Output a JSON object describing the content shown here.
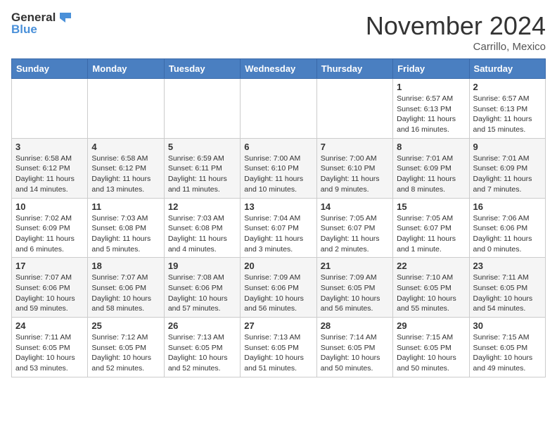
{
  "header": {
    "logo_general": "General",
    "logo_blue": "Blue",
    "month_title": "November 2024",
    "location": "Carrillo, Mexico"
  },
  "calendar": {
    "days_of_week": [
      "Sunday",
      "Monday",
      "Tuesday",
      "Wednesday",
      "Thursday",
      "Friday",
      "Saturday"
    ],
    "weeks": [
      [
        {
          "day": "",
          "info": ""
        },
        {
          "day": "",
          "info": ""
        },
        {
          "day": "",
          "info": ""
        },
        {
          "day": "",
          "info": ""
        },
        {
          "day": "",
          "info": ""
        },
        {
          "day": "1",
          "info": "Sunrise: 6:57 AM\nSunset: 6:13 PM\nDaylight: 11 hours\nand 16 minutes."
        },
        {
          "day": "2",
          "info": "Sunrise: 6:57 AM\nSunset: 6:13 PM\nDaylight: 11 hours\nand 15 minutes."
        }
      ],
      [
        {
          "day": "3",
          "info": "Sunrise: 6:58 AM\nSunset: 6:12 PM\nDaylight: 11 hours\nand 14 minutes."
        },
        {
          "day": "4",
          "info": "Sunrise: 6:58 AM\nSunset: 6:12 PM\nDaylight: 11 hours\nand 13 minutes."
        },
        {
          "day": "5",
          "info": "Sunrise: 6:59 AM\nSunset: 6:11 PM\nDaylight: 11 hours\nand 11 minutes."
        },
        {
          "day": "6",
          "info": "Sunrise: 7:00 AM\nSunset: 6:10 PM\nDaylight: 11 hours\nand 10 minutes."
        },
        {
          "day": "7",
          "info": "Sunrise: 7:00 AM\nSunset: 6:10 PM\nDaylight: 11 hours\nand 9 minutes."
        },
        {
          "day": "8",
          "info": "Sunrise: 7:01 AM\nSunset: 6:09 PM\nDaylight: 11 hours\nand 8 minutes."
        },
        {
          "day": "9",
          "info": "Sunrise: 7:01 AM\nSunset: 6:09 PM\nDaylight: 11 hours\nand 7 minutes."
        }
      ],
      [
        {
          "day": "10",
          "info": "Sunrise: 7:02 AM\nSunset: 6:09 PM\nDaylight: 11 hours\nand 6 minutes."
        },
        {
          "day": "11",
          "info": "Sunrise: 7:03 AM\nSunset: 6:08 PM\nDaylight: 11 hours\nand 5 minutes."
        },
        {
          "day": "12",
          "info": "Sunrise: 7:03 AM\nSunset: 6:08 PM\nDaylight: 11 hours\nand 4 minutes."
        },
        {
          "day": "13",
          "info": "Sunrise: 7:04 AM\nSunset: 6:07 PM\nDaylight: 11 hours\nand 3 minutes."
        },
        {
          "day": "14",
          "info": "Sunrise: 7:05 AM\nSunset: 6:07 PM\nDaylight: 11 hours\nand 2 minutes."
        },
        {
          "day": "15",
          "info": "Sunrise: 7:05 AM\nSunset: 6:07 PM\nDaylight: 11 hours\nand 1 minute."
        },
        {
          "day": "16",
          "info": "Sunrise: 7:06 AM\nSunset: 6:06 PM\nDaylight: 11 hours\nand 0 minutes."
        }
      ],
      [
        {
          "day": "17",
          "info": "Sunrise: 7:07 AM\nSunset: 6:06 PM\nDaylight: 10 hours\nand 59 minutes."
        },
        {
          "day": "18",
          "info": "Sunrise: 7:07 AM\nSunset: 6:06 PM\nDaylight: 10 hours\nand 58 minutes."
        },
        {
          "day": "19",
          "info": "Sunrise: 7:08 AM\nSunset: 6:06 PM\nDaylight: 10 hours\nand 57 minutes."
        },
        {
          "day": "20",
          "info": "Sunrise: 7:09 AM\nSunset: 6:06 PM\nDaylight: 10 hours\nand 56 minutes."
        },
        {
          "day": "21",
          "info": "Sunrise: 7:09 AM\nSunset: 6:05 PM\nDaylight: 10 hours\nand 56 minutes."
        },
        {
          "day": "22",
          "info": "Sunrise: 7:10 AM\nSunset: 6:05 PM\nDaylight: 10 hours\nand 55 minutes."
        },
        {
          "day": "23",
          "info": "Sunrise: 7:11 AM\nSunset: 6:05 PM\nDaylight: 10 hours\nand 54 minutes."
        }
      ],
      [
        {
          "day": "24",
          "info": "Sunrise: 7:11 AM\nSunset: 6:05 PM\nDaylight: 10 hours\nand 53 minutes."
        },
        {
          "day": "25",
          "info": "Sunrise: 7:12 AM\nSunset: 6:05 PM\nDaylight: 10 hours\nand 52 minutes."
        },
        {
          "day": "26",
          "info": "Sunrise: 7:13 AM\nSunset: 6:05 PM\nDaylight: 10 hours\nand 52 minutes."
        },
        {
          "day": "27",
          "info": "Sunrise: 7:13 AM\nSunset: 6:05 PM\nDaylight: 10 hours\nand 51 minutes."
        },
        {
          "day": "28",
          "info": "Sunrise: 7:14 AM\nSunset: 6:05 PM\nDaylight: 10 hours\nand 50 minutes."
        },
        {
          "day": "29",
          "info": "Sunrise: 7:15 AM\nSunset: 6:05 PM\nDaylight: 10 hours\nand 50 minutes."
        },
        {
          "day": "30",
          "info": "Sunrise: 7:15 AM\nSunset: 6:05 PM\nDaylight: 10 hours\nand 49 minutes."
        }
      ]
    ]
  }
}
